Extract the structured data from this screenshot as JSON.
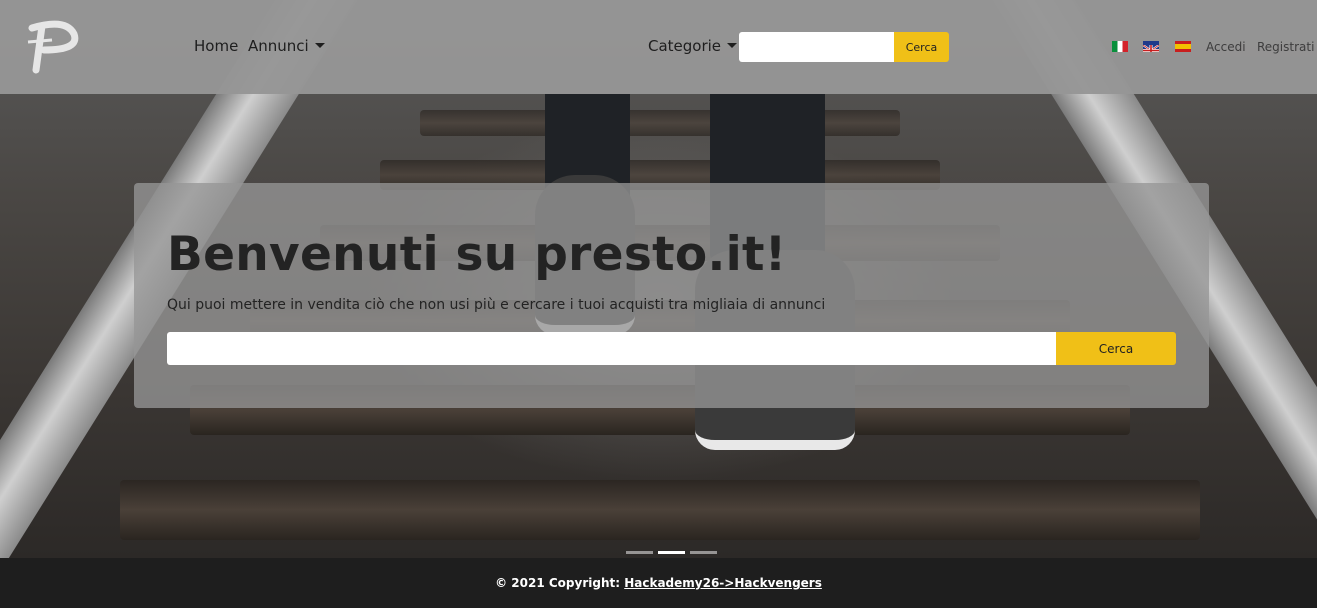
{
  "brand": {
    "logo_icon": "presto-logo-p"
  },
  "nav": {
    "home": "Home",
    "annunci": "Annunci",
    "categorie": "Categorie",
    "search_button": "Cerca",
    "search_placeholder": "",
    "languages": [
      {
        "code": "it",
        "icon": "flag-italy-icon"
      },
      {
        "code": "en",
        "icon": "flag-uk-icon"
      },
      {
        "code": "es",
        "icon": "flag-spain-icon"
      }
    ],
    "login": "Accedi",
    "register": "Registrati"
  },
  "hero": {
    "title": "Benvenuti su presto.it!",
    "subtitle": "Qui puoi mettere in vendita ciò che non usi più e cercare i tuoi acquisti tra migliaia di annunci",
    "search_placeholder": "",
    "search_button": "Cerca"
  },
  "carousel": {
    "slides": 3,
    "active_index": 1
  },
  "footer": {
    "copyright": "© 2021 Copyright: ",
    "link": "Hackademy26->Hackvengers"
  },
  "colors": {
    "accent": "#f0c017",
    "navbar": "#969696",
    "footer": "#1e1e1e"
  }
}
